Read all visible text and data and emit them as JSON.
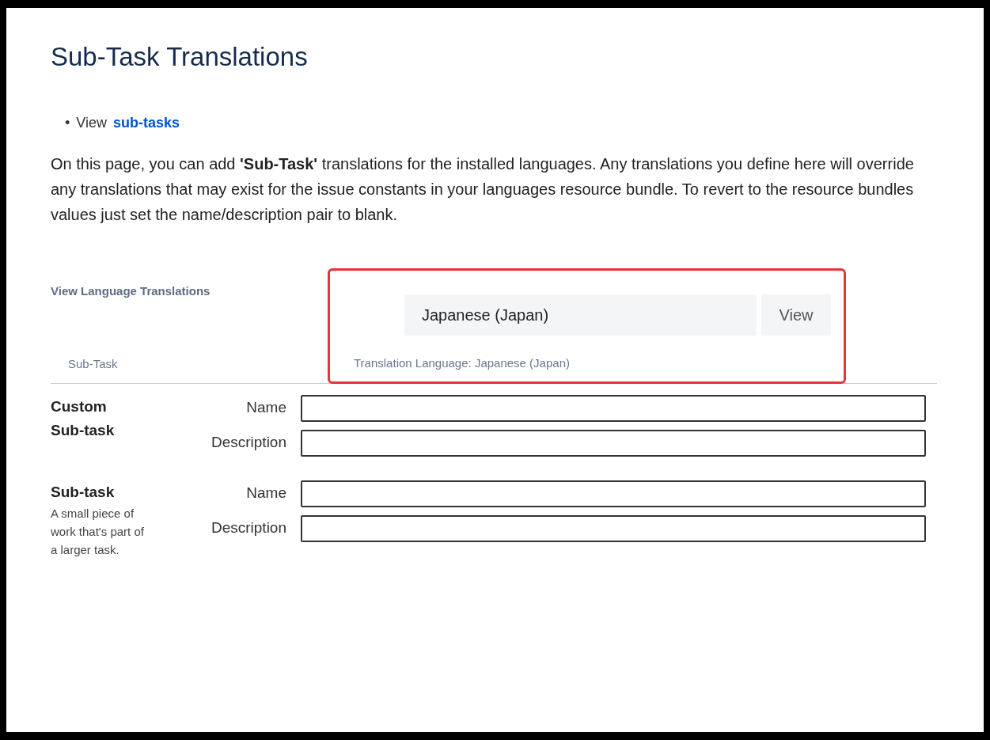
{
  "title": "Sub-Task Translations",
  "links": [
    {
      "bullet": "•",
      "prefix": "View",
      "link": "sub-tasks"
    }
  ],
  "intro": "On this page, you can add **'Sub-Task'** translations for the installed languages. Any translations you define here will override any translations that may exist for the issue constants in your languages resource bundle. To revert to the resource bundles values just set the name/description pair to blank.",
  "section_label": "View Language Translations",
  "language_selector": {
    "value": "Japanese (Japan)",
    "button": "View",
    "highlighted": true
  },
  "table": {
    "columns": [
      "Sub-Task",
      "Translation Language: Japanese (Japan)"
    ],
    "rows": [
      {
        "name": "Custom Sub-task",
        "description": "",
        "fields": [
          {
            "label": "Name"
          },
          {
            "label": "Description"
          }
        ]
      },
      {
        "name": "Sub-task",
        "description": "A small piece of work that's part of a larger task.",
        "fields": [
          {
            "label": "Name"
          },
          {
            "label": "Description"
          }
        ]
      }
    ]
  }
}
